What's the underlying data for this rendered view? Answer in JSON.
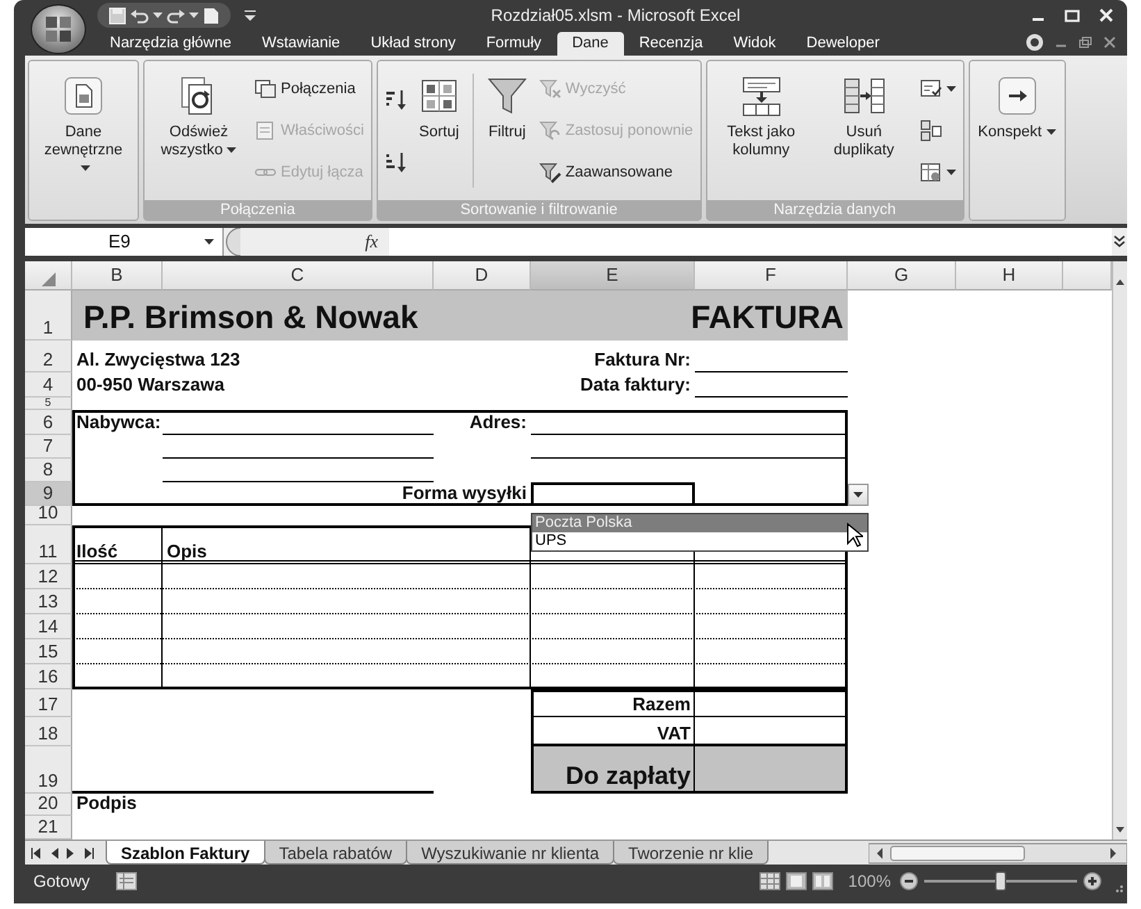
{
  "window": {
    "title": "Rozdział05.xlsm - Microsoft Excel"
  },
  "ribbon_tabs": [
    {
      "label": "Narzędzia główne",
      "selected": false
    },
    {
      "label": "Wstawianie",
      "selected": false
    },
    {
      "label": "Układ strony",
      "selected": false
    },
    {
      "label": "Formuły",
      "selected": false
    },
    {
      "label": "Dane",
      "selected": true
    },
    {
      "label": "Recenzja",
      "selected": false
    },
    {
      "label": "Widok",
      "selected": false
    },
    {
      "label": "Deweloper",
      "selected": false
    }
  ],
  "ribbon_groups": [
    {
      "items": [
        {
          "kind": "large",
          "label": "Dane zewnętrzne",
          "dropdown": true,
          "disabled": false
        }
      ]
    },
    {
      "label": "Połączenia",
      "items": [
        {
          "kind": "large",
          "label": "Odśwież wszystko",
          "dropdown": true,
          "disabled": false
        },
        {
          "kind": "stack",
          "items": [
            {
              "label": "Połączenia",
              "dropdown": false,
              "disabled": false
            },
            {
              "label": "Właściwości",
              "dropdown": false,
              "disabled": true
            },
            {
              "label": "Edytuj łącza",
              "dropdown": false,
              "disabled": true
            }
          ]
        }
      ]
    },
    {
      "label": "Sortowanie i filtrowanie",
      "items": [
        {
          "kind": "stack",
          "items": [
            {
              "dropdown": false,
              "disabled": false
            },
            {
              "dropdown": false,
              "disabled": false
            }
          ]
        },
        {
          "kind": "large",
          "label": "Sortuj",
          "dropdown": false,
          "disabled": false
        },
        {
          "kind": "separator"
        },
        {
          "kind": "large",
          "label": "Filtruj",
          "dropdown": false,
          "disabled": false
        },
        {
          "kind": "stack",
          "items": [
            {
              "label": "Wyczyść",
              "dropdown": false,
              "disabled": true
            },
            {
              "label": "Zastosuj ponownie",
              "dropdown": false,
              "disabled": true
            },
            {
              "label": "Zaawansowane",
              "dropdown": false,
              "disabled": false
            }
          ]
        }
      ]
    },
    {
      "label": "Narzędzia danych",
      "items": [
        {
          "kind": "large",
          "label": "Tekst jako kolumny",
          "dropdown": false,
          "disabled": false
        },
        {
          "kind": "large",
          "label": "Usuń duplikaty",
          "dropdown": false,
          "disabled": false
        },
        {
          "kind": "stack",
          "items": [
            {
              "dropdown": true,
              "disabled": false
            },
            {
              "dropdown": false,
              "disabled": false
            },
            {
              "dropdown": true,
              "disabled": false
            }
          ]
        }
      ]
    },
    {
      "items": [
        {
          "kind": "large",
          "label": "Konspekt",
          "dropdown": true,
          "disabled": false
        }
      ]
    }
  ],
  "formula_bar": {
    "name_box": "E9",
    "function_label": "fx"
  },
  "columns": [
    {
      "label": "B",
      "selected": false
    },
    {
      "label": "C",
      "selected": false
    },
    {
      "label": "D",
      "selected": false
    },
    {
      "label": "E",
      "selected": true
    },
    {
      "label": "F",
      "selected": false
    },
    {
      "label": "G",
      "selected": false
    },
    {
      "label": "H",
      "selected": false
    }
  ],
  "rows": [
    {
      "label": "1",
      "selected": false,
      "cells": {
        "B": {
          "text": "P.P. Brimson & Nowak",
          "kind": "title"
        },
        "F": {
          "text": "FAKTURA",
          "kind": "doctype"
        }
      }
    },
    {
      "label": "2",
      "selected": false,
      "cells": {
        "B": {
          "text": "Al. Zwycięstwa 123",
          "kind": "label"
        },
        "E": {
          "text": "Faktura Nr:",
          "kind": "field"
        }
      }
    },
    {
      "label": "4",
      "selected": false,
      "cells": {
        "B": {
          "text": "00-950 Warszawa",
          "kind": "label"
        },
        "E": {
          "text": "Data faktury:",
          "kind": "field"
        }
      }
    },
    {
      "label": "5",
      "selected": false
    },
    {
      "label": "6",
      "selected": false,
      "cells": {
        "B": {
          "text": "Nabywca:",
          "kind": "label"
        },
        "D": {
          "text": "Adres:",
          "kind": "field"
        }
      }
    },
    {
      "label": "7",
      "selected": false
    },
    {
      "label": "8",
      "selected": false
    },
    {
      "label": "9",
      "selected": true,
      "cells": {
        "D": {
          "text": "Forma wysyłki",
          "kind": "field"
        }
      }
    },
    {
      "label": "10",
      "selected": false
    },
    {
      "label": "11",
      "selected": false,
      "cells": {
        "B": {
          "text": "Ilość",
          "kind": "label"
        },
        "C": {
          "text": "Opis",
          "kind": "label"
        }
      }
    },
    {
      "label": "12",
      "selected": false
    },
    {
      "label": "13",
      "selected": false
    },
    {
      "label": "14",
      "selected": false
    },
    {
      "label": "15",
      "selected": false
    },
    {
      "label": "16",
      "selected": false
    },
    {
      "label": "17",
      "selected": false,
      "cells": {
        "E": {
          "text": "Razem",
          "kind": "field"
        }
      }
    },
    {
      "label": "18",
      "selected": false,
      "cells": {
        "E": {
          "text": "VAT",
          "kind": "field"
        }
      }
    },
    {
      "label": "19",
      "selected": false,
      "cells": {
        "E": {
          "text": "Do zapłaty",
          "kind": "total"
        }
      }
    },
    {
      "label": "20",
      "selected": false,
      "cells": {
        "B": {
          "text": "Podpis",
          "kind": "label"
        }
      }
    },
    {
      "label": "21",
      "selected": false
    }
  ],
  "dropdown_list": {
    "items": [
      {
        "label": "Poczta Polska",
        "selected": true
      },
      {
        "label": "UPS",
        "selected": false
      }
    ]
  },
  "sheet_tabs": [
    {
      "label": "Szablon Faktury",
      "selected": true
    },
    {
      "label": "Tabela rabatów",
      "selected": false
    },
    {
      "label": "Wyszukiwanie nr klienta",
      "selected": false
    },
    {
      "label": "Tworzenie nr klie",
      "selected": false
    }
  ],
  "status_bar": {
    "status": "Gotowy",
    "zoom": "100%",
    "zoom_slider": {
      "level": 0.5
    }
  }
}
